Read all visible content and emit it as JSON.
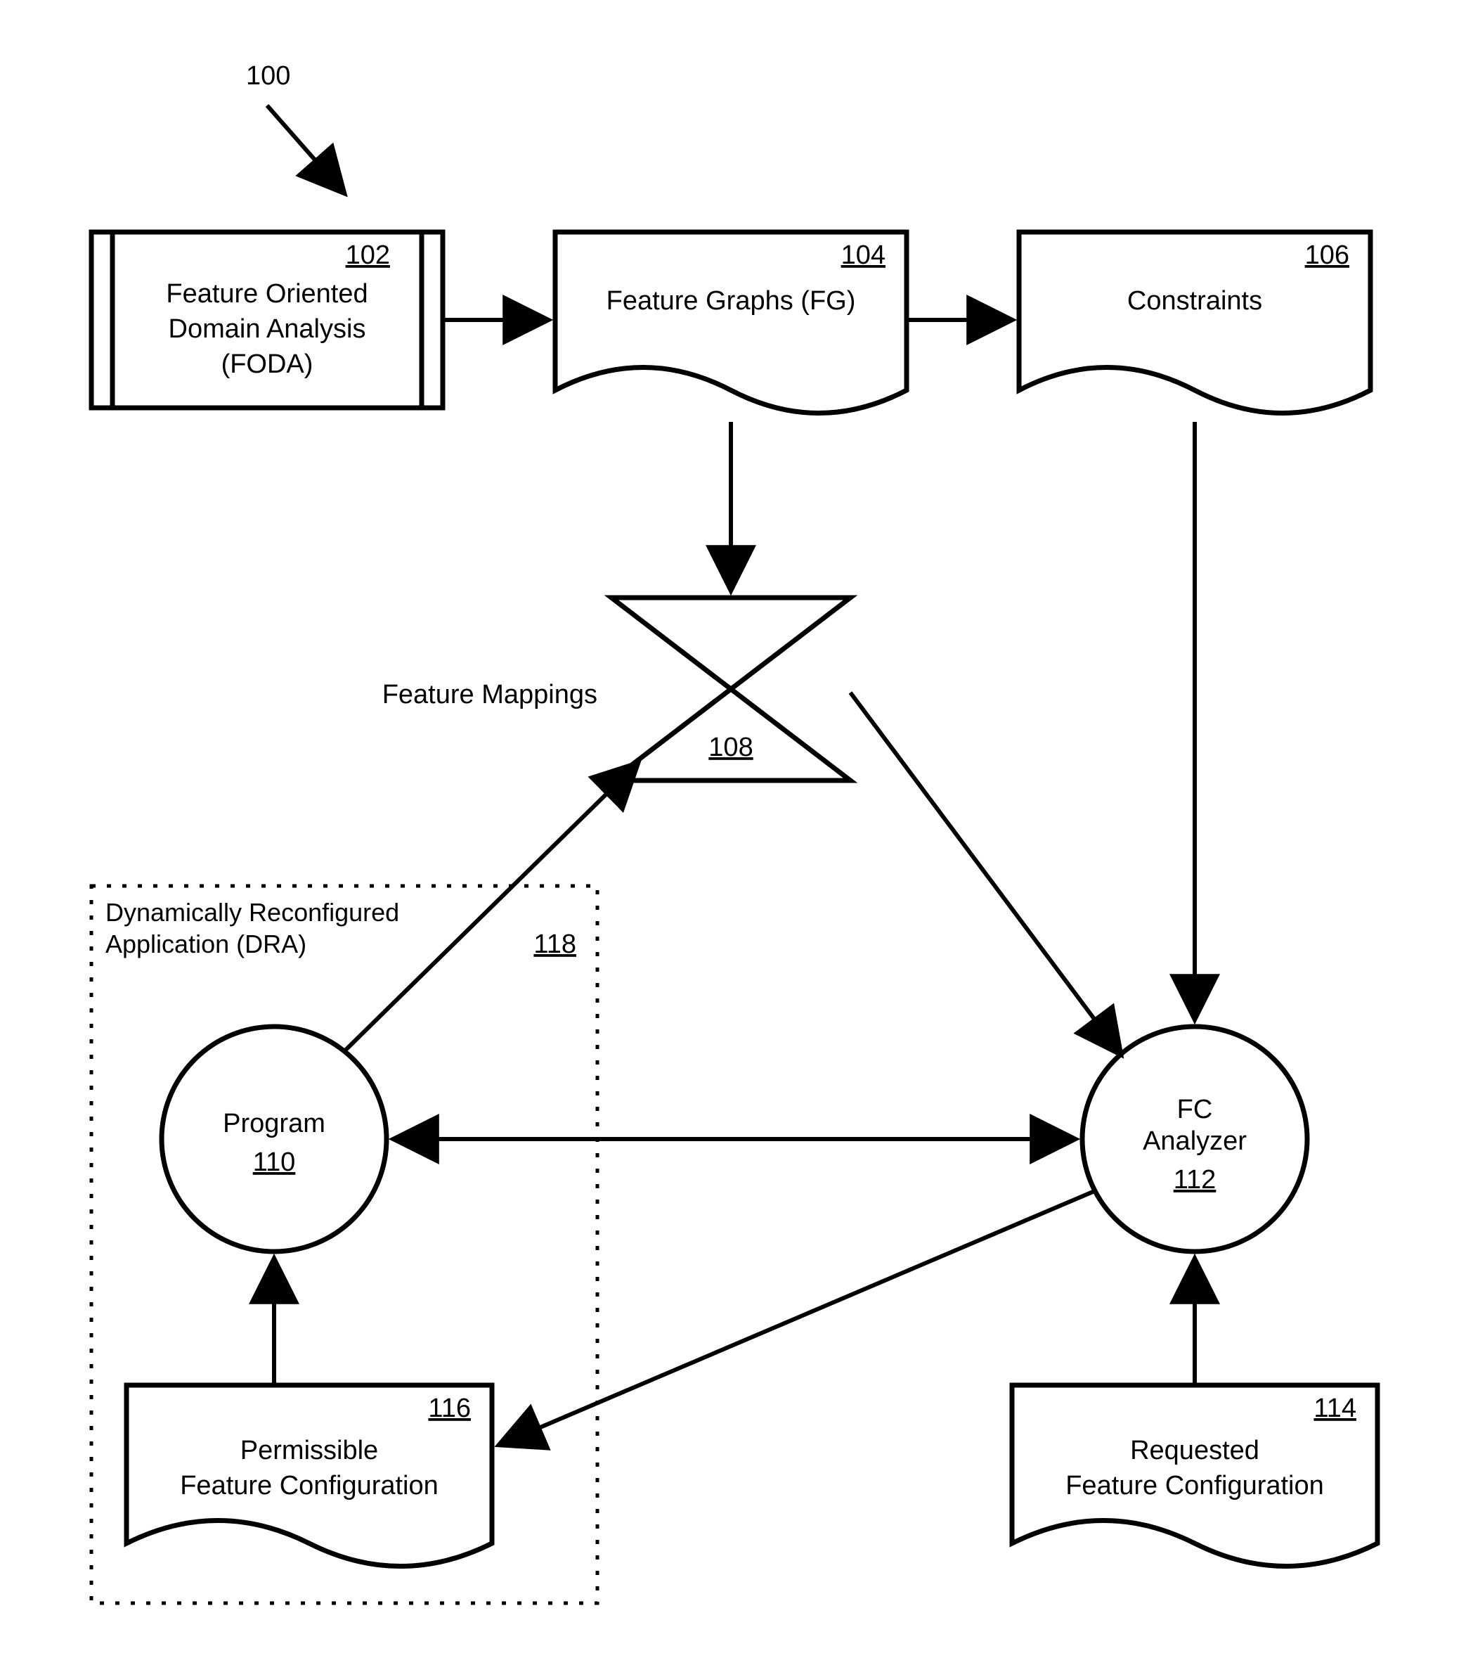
{
  "figure_number": "100",
  "nodes": {
    "foda": {
      "id": "102",
      "title_l1": "Feature Oriented",
      "title_l2": "Domain Analysis",
      "title_l3": "(FODA)"
    },
    "fg": {
      "id": "104",
      "title": "Feature Graphs (FG)"
    },
    "con": {
      "id": "106",
      "title": "Constraints"
    },
    "fm": {
      "id": "108",
      "title": "Feature Mappings"
    },
    "prog": {
      "id": "110",
      "title": "Program"
    },
    "fca": {
      "id": "112",
      "title_l1": "FC",
      "title_l2": "Analyzer"
    },
    "req": {
      "id": "114",
      "title_l1": "Requested",
      "title_l2": "Feature Configuration"
    },
    "perm": {
      "id": "116",
      "title_l1": "Permissible",
      "title_l2": "Feature Configuration"
    },
    "dra": {
      "id": "118",
      "title_l1": "Dynamically Reconfigured",
      "title_l2": "Application (DRA)"
    }
  }
}
